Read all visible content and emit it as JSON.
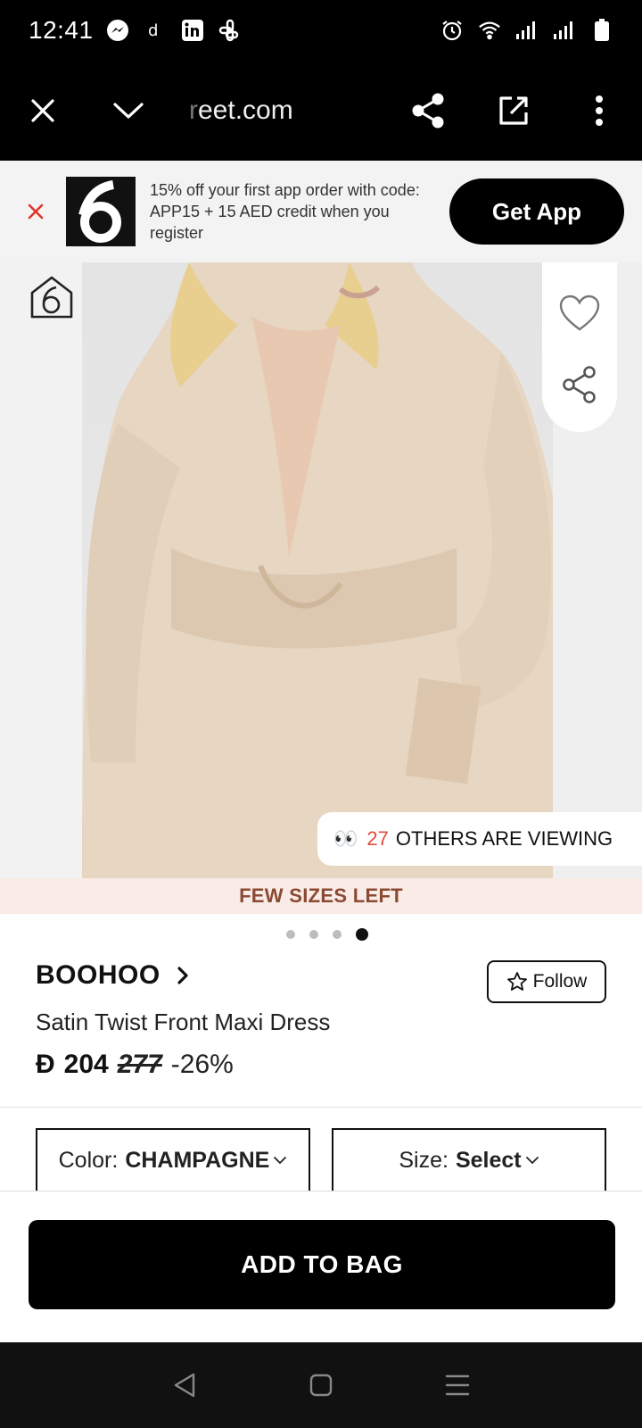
{
  "status_bar": {
    "time": "12:41",
    "left_icons": [
      "messenger-icon",
      "d-icon",
      "linkedin-icon",
      "slack-icon"
    ],
    "right_icons": [
      "alarm-icon",
      "wifi-icon",
      "signal-icon",
      "signal-icon",
      "battery-icon"
    ]
  },
  "browser": {
    "url_fade": "r",
    "url": "eet.com"
  },
  "app_banner": {
    "text": "15% off your first app order with code: APP15 + 15 AED credit when you register",
    "button": "Get App"
  },
  "product_image": {
    "viewers_count": "27",
    "viewers_text": "OTHERS ARE VIEWING"
  },
  "few_sizes": "FEW SIZES LEFT",
  "carousel": {
    "total": 4,
    "active": 4
  },
  "product": {
    "brand": "BOOHOO",
    "follow": "Follow",
    "name": "Satin Twist Front Maxi Dress",
    "currency": "Đ",
    "price": "204",
    "old_price": "277",
    "discount": "-26%"
  },
  "selectors": {
    "color_label": "Color:",
    "color_value": "CHAMPAGNE",
    "size_label": "Size:",
    "size_value": "Select"
  },
  "cta": {
    "add_to_bag": "ADD TO BAG"
  },
  "colors": {
    "viewers_accent": "#e24b3a",
    "few_sizes_bg": "#f9ebe6",
    "few_sizes_text": "#8a4a33"
  }
}
